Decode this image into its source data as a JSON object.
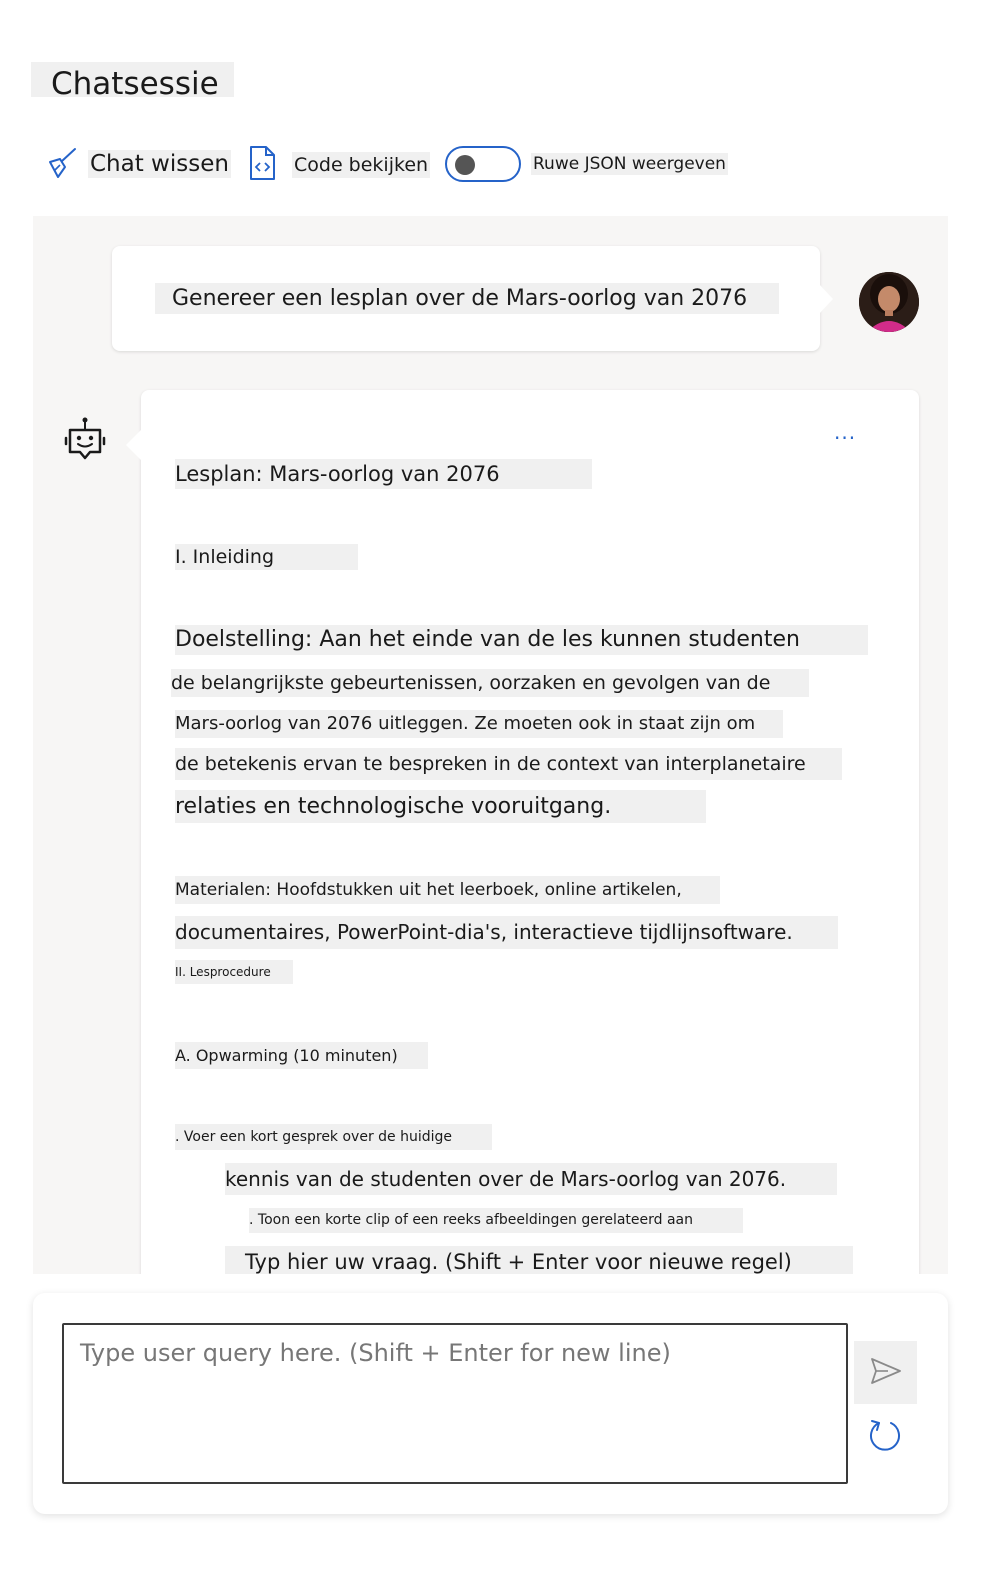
{
  "header": {
    "title": "Chatsessie"
  },
  "toolbar": {
    "clear_label": "Chat wissen",
    "code_label": "Code bekijken",
    "json_toggle_label": "Ruwe JSON weergeven",
    "json_toggle_on": false
  },
  "conversation": {
    "user_message": "Genereer een lesplan over de Mars-oorlog van 2076",
    "more_options_label": "...",
    "assistant_lines": [
      "Lesplan: Mars-oorlog van 2076",
      "I. Inleiding",
      "Doelstelling: Aan het einde van de les kunnen studenten",
      "de belangrijkste gebeurtenissen, oorzaken en gevolgen van de",
      "Mars-oorlog van 2076 uitleggen. Ze moeten ook in staat zijn om",
      "de betekenis ervan te bespreken in de context van interplanetaire",
      "relaties en technologische vooruitgang.",
      "Materialen: Hoofdstukken uit het leerboek, online artikelen,",
      "documentaires, PowerPoint-dia's, interactieve tijdlijnsoftware.",
      "II. Lesprocedure",
      "A. Opwarming (10 minuten)",
      ". Voer een kort gesprek over de huidige",
      "kennis van de studenten over de Mars-oorlog van 2076.",
      ". Toon een korte clip of een reeks afbeeldingen gerelateerd aan",
      "Typ hier uw vraag. (Shift + Enter voor nieuwe regel)"
    ]
  },
  "input": {
    "placeholder": "Type user query here. (Shift + Enter for new line)",
    "value": ""
  },
  "icons": {
    "clear": "broom-icon",
    "code": "code-file-icon",
    "bot": "bot-icon",
    "send": "send-icon",
    "reset": "refresh-icon"
  },
  "colors": {
    "accent": "#2563c9",
    "chat_background": "#f7f6f5",
    "text_highlight": "#f0f0f0"
  }
}
